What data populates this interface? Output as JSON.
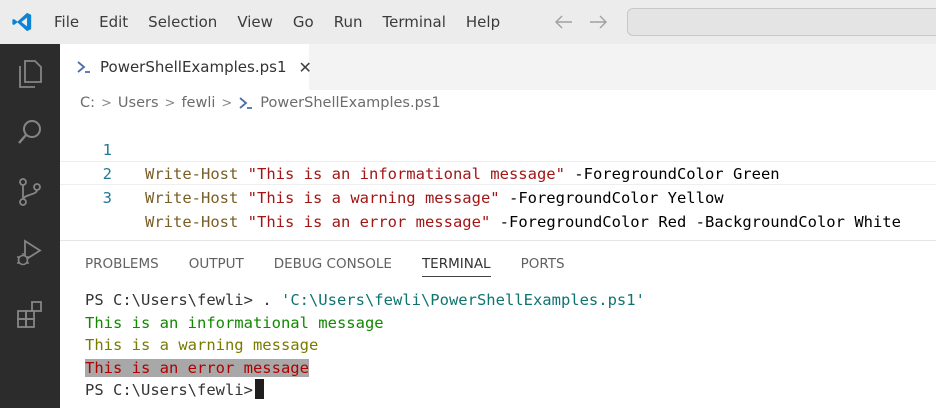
{
  "menu": [
    "File",
    "Edit",
    "Selection",
    "View",
    "Go",
    "Run",
    "Terminal",
    "Help"
  ],
  "tab": {
    "label": "PowerShellExamples.ps1",
    "close": "✕"
  },
  "breadcrumb": [
    "C:",
    "Users",
    "fewli",
    "PowerShellExamples.ps1"
  ],
  "code": [
    {
      "num": "1",
      "cmd": "Write-Host",
      "str": "\"This is an informational message\"",
      "param": "-ForegroundColor",
      "arg": "Green",
      "param2": "",
      "arg2": ""
    },
    {
      "num": "2",
      "cmd": "Write-Host",
      "str": "\"This is a warning message\"",
      "param": "-ForegroundColor",
      "arg": "Yellow",
      "param2": "",
      "arg2": ""
    },
    {
      "num": "3",
      "cmd": "Write-Host",
      "str": "\"This is an error message\"",
      "param": "-ForegroundColor",
      "arg": "Red",
      "param2": "-BackgroundColor",
      "arg2": "White"
    }
  ],
  "panel_tabs": [
    "PROBLEMS",
    "OUTPUT",
    "DEBUG CONSOLE",
    "TERMINAL",
    "PORTS"
  ],
  "active_panel_tab": "TERMINAL",
  "terminal": {
    "prompt1": "PS C:\\Users\\fewli> ",
    "dot": ". ",
    "path": "'C:\\Users\\fewli\\PowerShellExamples.ps1'",
    "out_green": "This is an informational message",
    "out_yellow": "This is a warning message",
    "out_red": "This is an error message",
    "prompt2": "PS C:\\Users\\fewli>"
  },
  "colors": {
    "accent": "#007acc",
    "activity_bar": "#2c2c2c",
    "title_bar": "#ececec"
  }
}
